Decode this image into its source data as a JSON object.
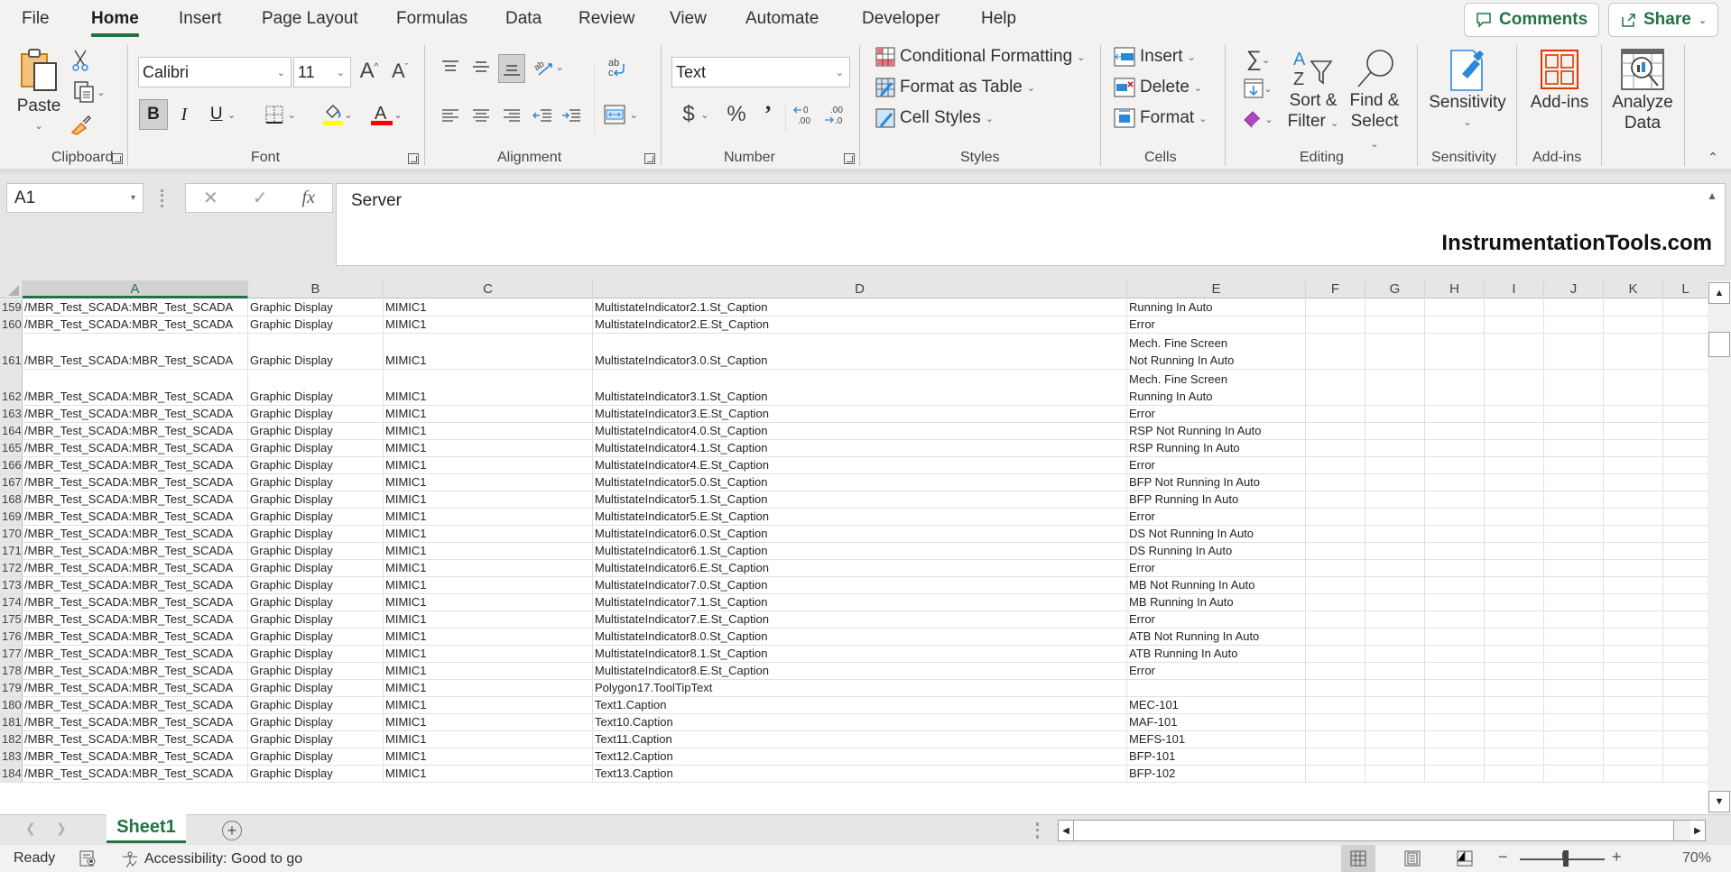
{
  "menu": {
    "tabs": [
      "File",
      "Home",
      "Insert",
      "Page Layout",
      "Formulas",
      "Data",
      "Review",
      "View",
      "Automate",
      "Developer",
      "Help"
    ],
    "active_tab": "Home",
    "comments_label": "Comments",
    "share_label": "Share"
  },
  "ribbon": {
    "clipboard": {
      "paste_label": "Paste",
      "group_label": "Clipboard"
    },
    "font": {
      "name": "Calibri",
      "size": "11",
      "group_label": "Font",
      "bold": "B",
      "italic": "I",
      "underline": "U",
      "fill_color": "#ffff00",
      "font_color": "#ff0000"
    },
    "alignment": {
      "group_label": "Alignment"
    },
    "number": {
      "format": "Text",
      "group_label": "Number",
      "currency": "$",
      "percent": "%",
      "comma": "9"
    },
    "styles": {
      "conditional_formatting": "Conditional Formatting",
      "format_as_table": "Format as Table",
      "cell_styles": "Cell Styles",
      "group_label": "Styles"
    },
    "cells": {
      "insert": "Insert",
      "delete": "Delete",
      "format": "Format",
      "group_label": "Cells"
    },
    "editing": {
      "sort_filter_1": "Sort &",
      "sort_filter_2": "Filter",
      "find_select_1": "Find &",
      "find_select_2": "Select",
      "group_label": "Editing"
    },
    "sensitivity": {
      "label": "Sensitivity",
      "group_label": "Sensitivity"
    },
    "addins": {
      "label": "Add-ins",
      "group_label": "Add-ins"
    },
    "analyze": {
      "label_1": "Analyze",
      "label_2": "Data"
    }
  },
  "formula_bar": {
    "name_box": "A1",
    "formula": "Server",
    "watermark": "InstrumentationTools.com"
  },
  "grid": {
    "columns": [
      "A",
      "B",
      "C",
      "D",
      "E",
      "F",
      "G",
      "H",
      "I",
      "J",
      "K",
      "L"
    ],
    "selected_column": "A",
    "rows": [
      {
        "n": "159",
        "a": "/MBR_Test_SCADA:MBR_Test_SCADA",
        "b": "Graphic Display",
        "c": "MIMIC1",
        "d": "MultistateIndicator2.1.St_Caption",
        "e": [
          "Running In Auto"
        ]
      },
      {
        "n": "160",
        "a": "/MBR_Test_SCADA:MBR_Test_SCADA",
        "b": "Graphic Display",
        "c": "MIMIC1",
        "d": "MultistateIndicator2.E.St_Caption",
        "e": [
          "Error"
        ]
      },
      {
        "n": "161",
        "a": "/MBR_Test_SCADA:MBR_Test_SCADA",
        "b": "Graphic Display",
        "c": "MIMIC1",
        "d": "MultistateIndicator3.0.St_Caption",
        "e": [
          "Mech. Fine Screen",
          "Not Running In Auto"
        ]
      },
      {
        "n": "162",
        "a": "/MBR_Test_SCADA:MBR_Test_SCADA",
        "b": "Graphic Display",
        "c": "MIMIC1",
        "d": "MultistateIndicator3.1.St_Caption",
        "e": [
          "Mech. Fine Screen",
          "Running In Auto"
        ]
      },
      {
        "n": "163",
        "a": "/MBR_Test_SCADA:MBR_Test_SCADA",
        "b": "Graphic Display",
        "c": "MIMIC1",
        "d": "MultistateIndicator3.E.St_Caption",
        "e": [
          "Error"
        ]
      },
      {
        "n": "164",
        "a": "/MBR_Test_SCADA:MBR_Test_SCADA",
        "b": "Graphic Display",
        "c": "MIMIC1",
        "d": "MultistateIndicator4.0.St_Caption",
        "e": [
          "RSP Not Running In Auto"
        ]
      },
      {
        "n": "165",
        "a": "/MBR_Test_SCADA:MBR_Test_SCADA",
        "b": "Graphic Display",
        "c": "MIMIC1",
        "d": "MultistateIndicator4.1.St_Caption",
        "e": [
          "RSP Running In Auto"
        ]
      },
      {
        "n": "166",
        "a": "/MBR_Test_SCADA:MBR_Test_SCADA",
        "b": "Graphic Display",
        "c": "MIMIC1",
        "d": "MultistateIndicator4.E.St_Caption",
        "e": [
          "Error"
        ]
      },
      {
        "n": "167",
        "a": "/MBR_Test_SCADA:MBR_Test_SCADA",
        "b": "Graphic Display",
        "c": "MIMIC1",
        "d": "MultistateIndicator5.0.St_Caption",
        "e": [
          "BFP Not Running In Auto"
        ]
      },
      {
        "n": "168",
        "a": "/MBR_Test_SCADA:MBR_Test_SCADA",
        "b": "Graphic Display",
        "c": "MIMIC1",
        "d": "MultistateIndicator5.1.St_Caption",
        "e": [
          "BFP Running In Auto"
        ]
      },
      {
        "n": "169",
        "a": "/MBR_Test_SCADA:MBR_Test_SCADA",
        "b": "Graphic Display",
        "c": "MIMIC1",
        "d": "MultistateIndicator5.E.St_Caption",
        "e": [
          "Error"
        ]
      },
      {
        "n": "170",
        "a": "/MBR_Test_SCADA:MBR_Test_SCADA",
        "b": "Graphic Display",
        "c": "MIMIC1",
        "d": "MultistateIndicator6.0.St_Caption",
        "e": [
          "DS Not Running In Auto"
        ]
      },
      {
        "n": "171",
        "a": "/MBR_Test_SCADA:MBR_Test_SCADA",
        "b": "Graphic Display",
        "c": "MIMIC1",
        "d": "MultistateIndicator6.1.St_Caption",
        "e": [
          "DS Running In Auto"
        ]
      },
      {
        "n": "172",
        "a": "/MBR_Test_SCADA:MBR_Test_SCADA",
        "b": "Graphic Display",
        "c": "MIMIC1",
        "d": "MultistateIndicator6.E.St_Caption",
        "e": [
          "Error"
        ]
      },
      {
        "n": "173",
        "a": "/MBR_Test_SCADA:MBR_Test_SCADA",
        "b": "Graphic Display",
        "c": "MIMIC1",
        "d": "MultistateIndicator7.0.St_Caption",
        "e": [
          "MB Not Running In Auto"
        ]
      },
      {
        "n": "174",
        "a": "/MBR_Test_SCADA:MBR_Test_SCADA",
        "b": "Graphic Display",
        "c": "MIMIC1",
        "d": "MultistateIndicator7.1.St_Caption",
        "e": [
          "MB Running In Auto"
        ]
      },
      {
        "n": "175",
        "a": "/MBR_Test_SCADA:MBR_Test_SCADA",
        "b": "Graphic Display",
        "c": "MIMIC1",
        "d": "MultistateIndicator7.E.St_Caption",
        "e": [
          "Error"
        ]
      },
      {
        "n": "176",
        "a": "/MBR_Test_SCADA:MBR_Test_SCADA",
        "b": "Graphic Display",
        "c": "MIMIC1",
        "d": "MultistateIndicator8.0.St_Caption",
        "e": [
          "ATB Not Running In Auto"
        ]
      },
      {
        "n": "177",
        "a": "/MBR_Test_SCADA:MBR_Test_SCADA",
        "b": "Graphic Display",
        "c": "MIMIC1",
        "d": "MultistateIndicator8.1.St_Caption",
        "e": [
          "ATB Running In Auto"
        ]
      },
      {
        "n": "178",
        "a": "/MBR_Test_SCADA:MBR_Test_SCADA",
        "b": "Graphic Display",
        "c": "MIMIC1",
        "d": "MultistateIndicator8.E.St_Caption",
        "e": [
          "Error"
        ]
      },
      {
        "n": "179",
        "a": "/MBR_Test_SCADA:MBR_Test_SCADA",
        "b": "Graphic Display",
        "c": "MIMIC1",
        "d": "Polygon17.ToolTipText",
        "e": [
          ""
        ]
      },
      {
        "n": "180",
        "a": "/MBR_Test_SCADA:MBR_Test_SCADA",
        "b": "Graphic Display",
        "c": "MIMIC1",
        "d": "Text1.Caption",
        "e": [
          "MEC-101"
        ]
      },
      {
        "n": "181",
        "a": "/MBR_Test_SCADA:MBR_Test_SCADA",
        "b": "Graphic Display",
        "c": "MIMIC1",
        "d": "Text10.Caption",
        "e": [
          "MAF-101"
        ]
      },
      {
        "n": "182",
        "a": "/MBR_Test_SCADA:MBR_Test_SCADA",
        "b": "Graphic Display",
        "c": "MIMIC1",
        "d": "Text11.Caption",
        "e": [
          "MEFS-101"
        ]
      },
      {
        "n": "183",
        "a": "/MBR_Test_SCADA:MBR_Test_SCADA",
        "b": "Graphic Display",
        "c": "MIMIC1",
        "d": "Text12.Caption",
        "e": [
          "BFP-101"
        ]
      },
      {
        "n": "184",
        "a": "/MBR_Test_SCADA:MBR_Test_SCADA",
        "b": "Graphic Display",
        "c": "MIMIC1",
        "d": "Text13.Caption",
        "e": [
          "BFP-102"
        ]
      }
    ]
  },
  "sheets": {
    "tabs": [
      "Sheet1"
    ],
    "active": "Sheet1"
  },
  "status": {
    "ready": "Ready",
    "accessibility": "Accessibility: Good to go",
    "zoom": "70%",
    "zoom_minus": "−",
    "zoom_plus": "+"
  }
}
